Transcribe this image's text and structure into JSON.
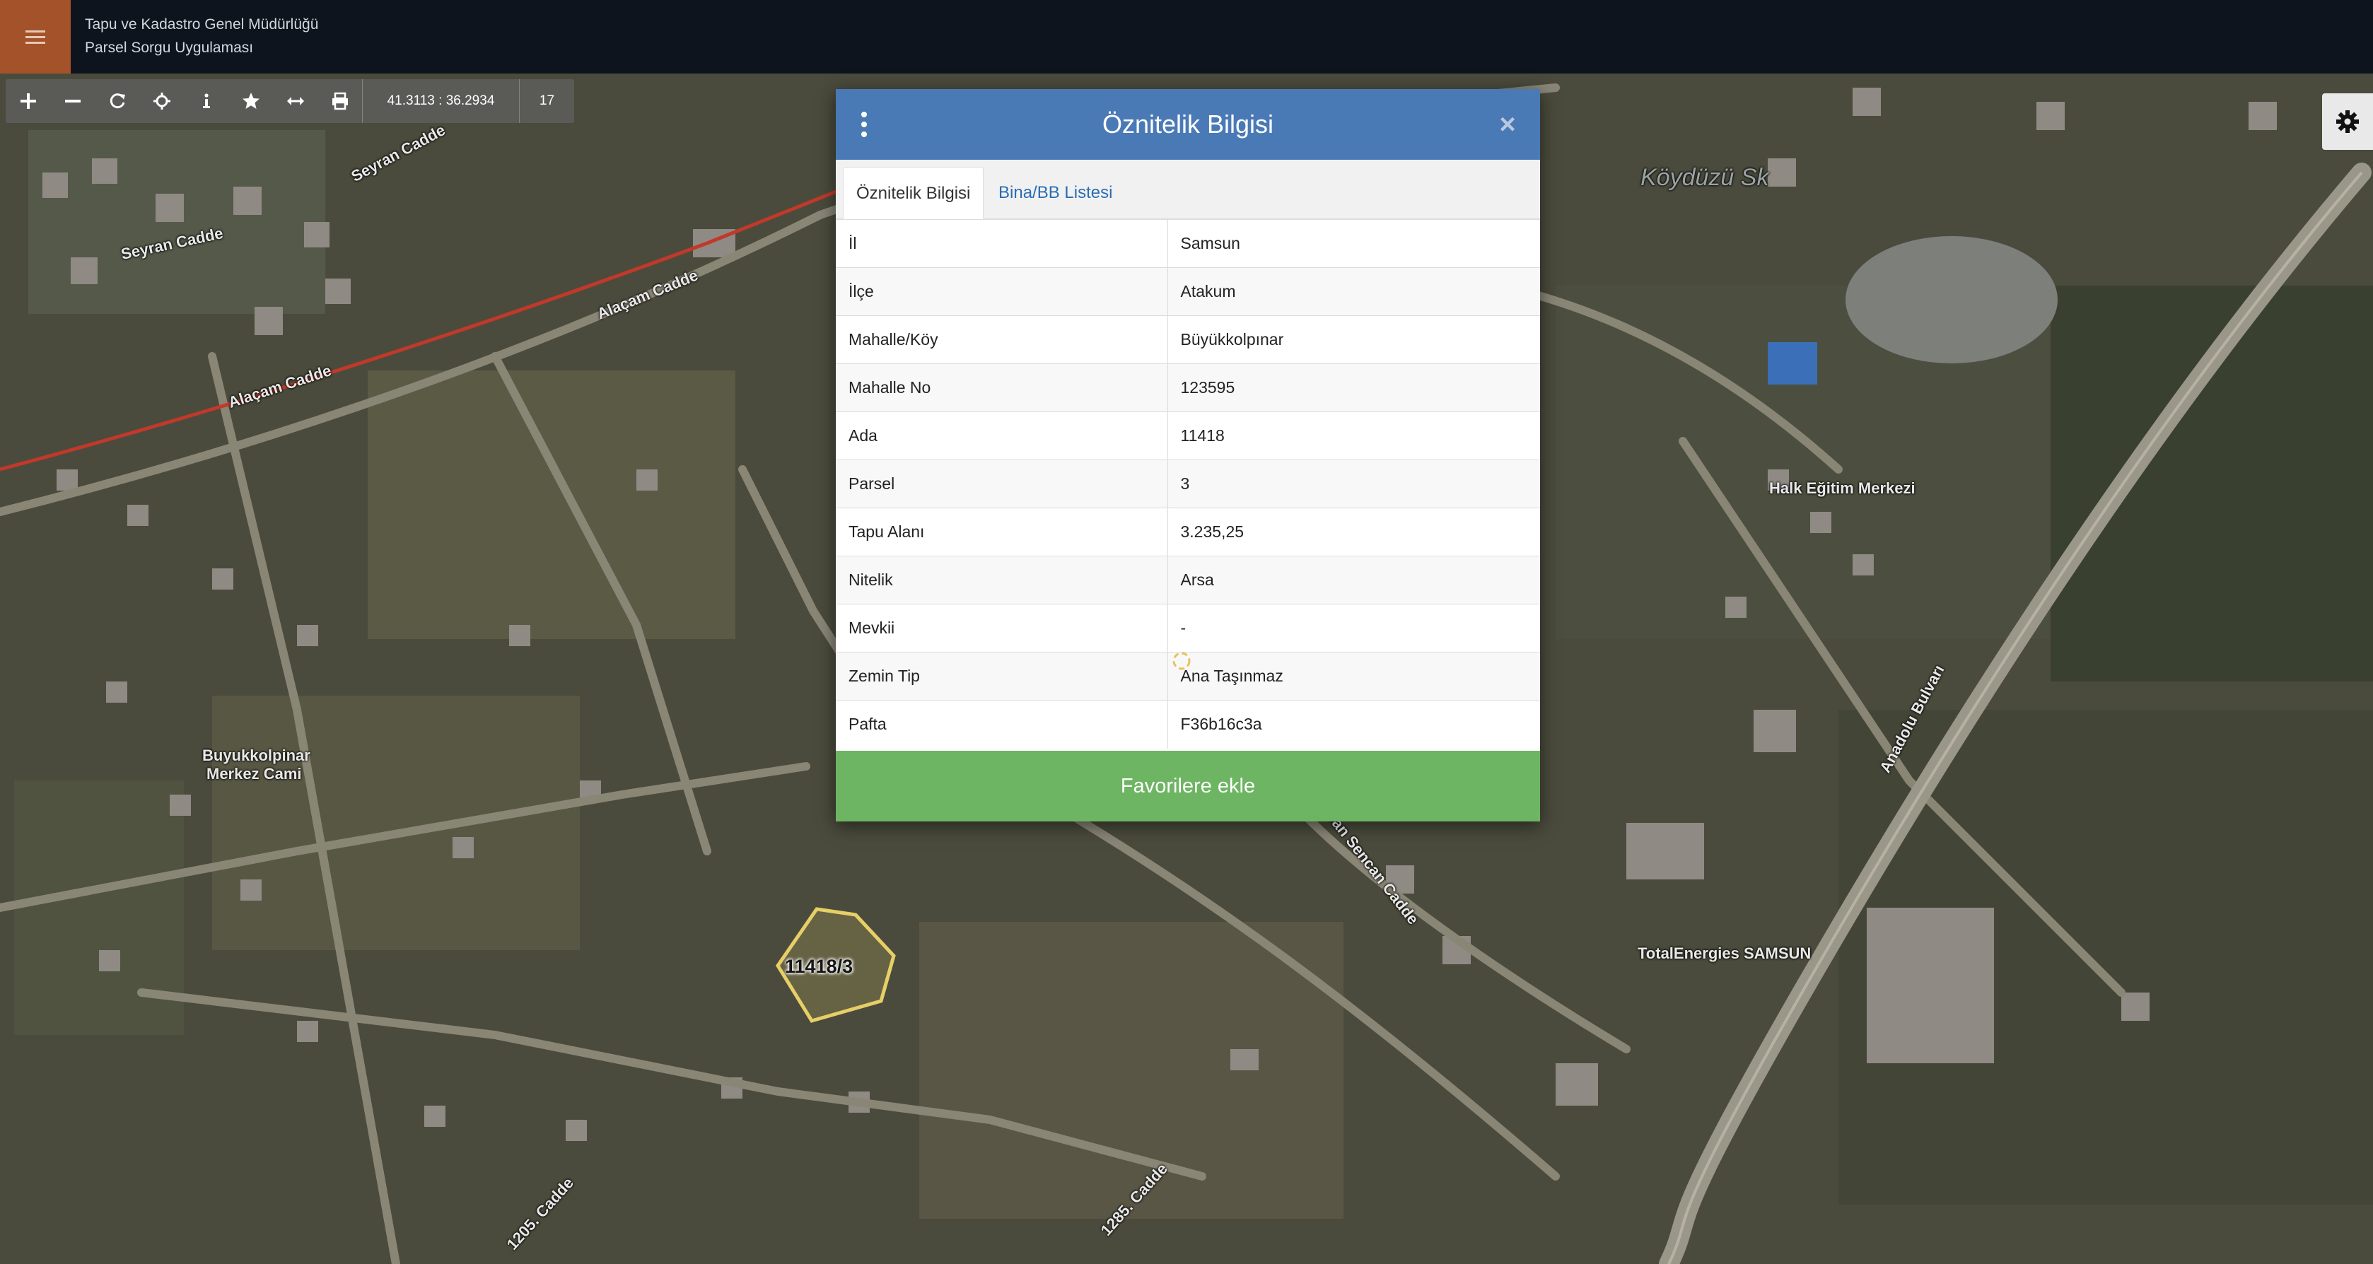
{
  "header": {
    "org_name": "Tapu ve Kadastro Genel Müdürlüğü",
    "app_name": "Parsel Sorgu Uygulaması",
    "menu_icon": "hamburger-icon",
    "colors": {
      "bar": "#0d141e",
      "menu_button": "#a3522a"
    }
  },
  "toolbar": {
    "tools": [
      "zoom-in-icon",
      "zoom-out-icon",
      "refresh-icon",
      "locate-icon",
      "info-icon",
      "star-icon",
      "measure-icon",
      "print-icon"
    ],
    "coordinates": "41.3113 : 36.2934",
    "zoom_level": "17"
  },
  "settings": {
    "icon": "gear-icon"
  },
  "map": {
    "labels": {
      "seyran_1": "Seyran Cadde",
      "seyran_2": "Seyran Cadde",
      "alacam_1": "Alaçam Cadde",
      "alacam_2": "Alaçam Cadde",
      "mosque_1": "Buyukkolpinar",
      "mosque_2": "Merkez Cami",
      "school": "Halk Eğitim Merkezi",
      "station": "TotalEnergies SAMSUN",
      "street_koy": "Köydüzü Sk",
      "anadolu": "Anadolu Bulvarı",
      "can_sencan": "Ahmet Can Sencan Cadde",
      "cadde_1285": "1285. Cadde",
      "cadde_1205": "1205. Cadde"
    },
    "parcel_label": "11418/3",
    "colors": {
      "parcel_outline": "#e7cf67",
      "main_road": "#c0392b"
    }
  },
  "dialog": {
    "title": "Öznitelik Bilgisi",
    "close_symbol": "×",
    "menu_icon": "kebab-menu-icon",
    "tabs": [
      {
        "label": "Öznitelik Bilgisi",
        "active": true
      },
      {
        "label": "Bina/BB Listesi",
        "active": false
      }
    ],
    "rows": [
      {
        "key": "İl",
        "value": "Samsun"
      },
      {
        "key": "İlçe",
        "value": "Atakum"
      },
      {
        "key": "Mahalle/Köy",
        "value": "Büyükkolpınar"
      },
      {
        "key": "Mahalle No",
        "value": "123595"
      },
      {
        "key": "Ada",
        "value": "11418"
      },
      {
        "key": "Parsel",
        "value": "3"
      },
      {
        "key": "Tapu Alanı",
        "value": "3.235,25"
      },
      {
        "key": "Nitelik",
        "value": "Arsa"
      },
      {
        "key": "Mevkii",
        "value": "-"
      },
      {
        "key": "Zemin Tip",
        "value": "Ana Taşınmaz"
      },
      {
        "key": "Pafta",
        "value": "F36b16c3a"
      }
    ],
    "favorite_button": "Favorilere ekle",
    "colors": {
      "header": "#4a7ab6",
      "button": "#6db563",
      "tab_link": "#2a6db3"
    }
  }
}
